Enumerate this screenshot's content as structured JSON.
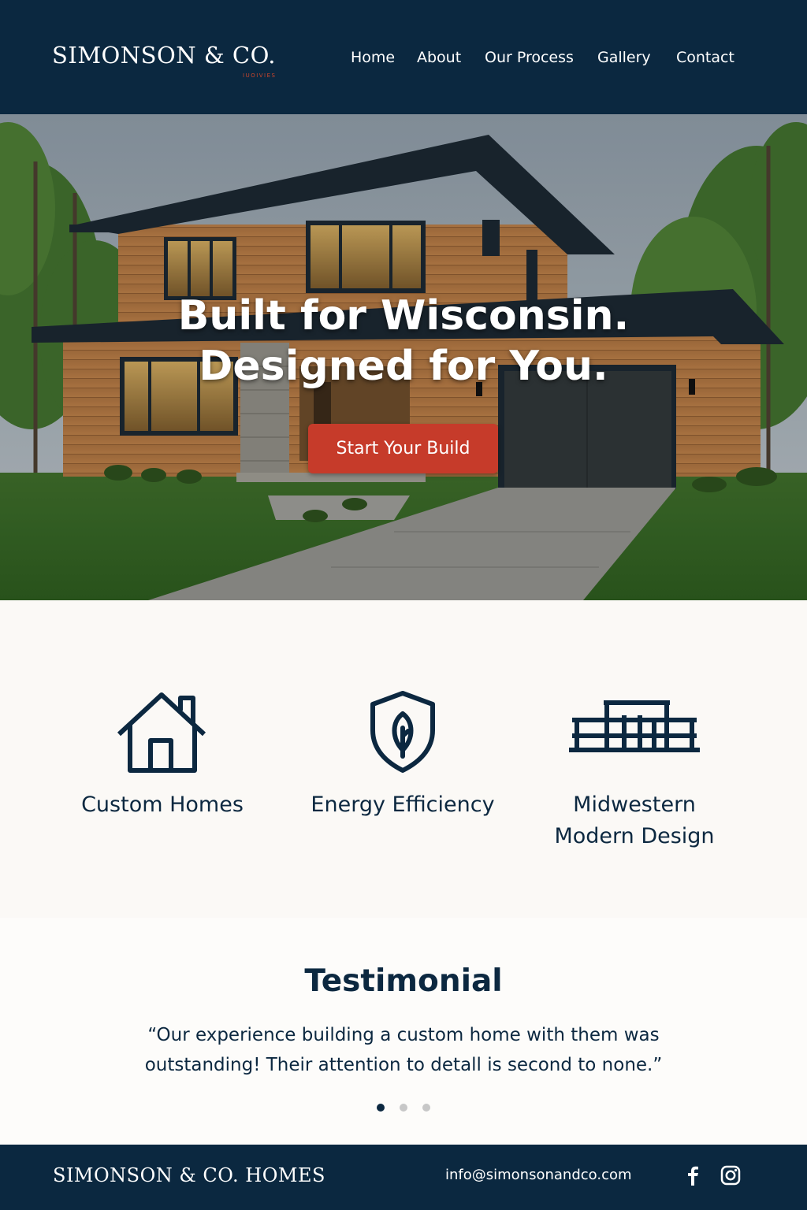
{
  "header": {
    "logo": "SIMONSON & CO.",
    "logo_sub": "IUOIVIES",
    "nav": [
      {
        "label": "Home"
      },
      {
        "label": "About"
      },
      {
        "label": "Our Process"
      },
      {
        "label": "Gallery"
      },
      {
        "label": "Contact"
      }
    ]
  },
  "hero": {
    "title_line1": "Built for Wisconsin.",
    "title_line2": "Designed for You.",
    "cta_label": "Start Your Build"
  },
  "features": [
    {
      "label": "Custom Homes",
      "icon": "house-icon"
    },
    {
      "label": "Energy Efficiency",
      "icon": "leaf-shield-icon"
    },
    {
      "label_line1": "Midwestern",
      "label_line2": "Modern Design",
      "icon": "modern-house-icon"
    }
  ],
  "testimonial": {
    "title": "Testimonial",
    "quote": "“Our experience building a custom home with them was outstanding! Their attention to detall is second to none.”",
    "active_slide": 1,
    "slide_count": 3
  },
  "footer": {
    "brand": "SIMONSON & CO. HOMES",
    "email": "info@simonsonandco.com",
    "social": [
      "facebook-icon",
      "instagram-icon"
    ]
  },
  "colors": {
    "navy": "#0b2840",
    "accent_red": "#c63b2a",
    "background": "#fbf9f6"
  }
}
